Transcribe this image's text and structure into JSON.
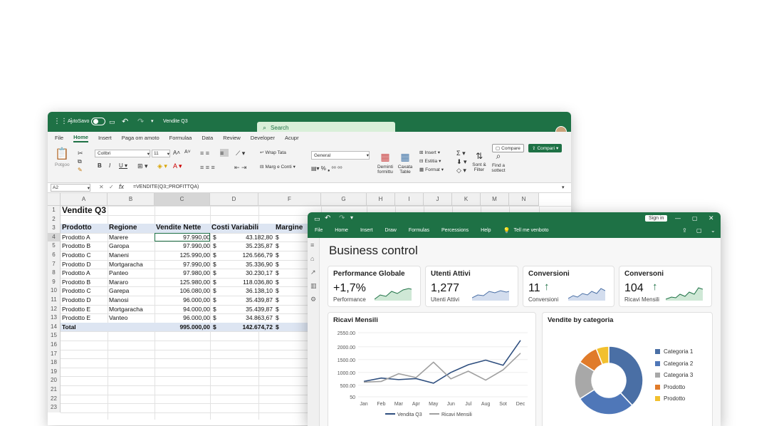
{
  "excel": {
    "autosave": "AutoSavo",
    "doc_title": "Vendite Q3",
    "search": "Search",
    "menu": [
      "File",
      "Home",
      "Insert",
      "Paga om amoto",
      "Formulaa",
      "Data",
      "Review",
      "Developer",
      "Acupr"
    ],
    "compare": "Compare",
    "share": "Compari",
    "ribbon": {
      "paste": "Potgoo",
      "font": "Collbri",
      "size": "11",
      "wrap": "Wrap Tata",
      "merge": "Marg e Conti",
      "numfmt": "General",
      "insert": "Insert",
      "delete": "Estitia",
      "format": "Format",
      "cond": "Deminti formittu",
      "table": "Caxata Table",
      "sort": "Sont & Filter",
      "find": "Find a sottect"
    },
    "namebox": "A2",
    "formula": "=VENDITE(Q3;;PROFITTQA)",
    "cols": [
      "A",
      "B",
      "C",
      "D",
      "F",
      "G",
      "H",
      "I",
      "J",
      "K",
      "M",
      "N"
    ],
    "title": "Vendite Q3",
    "headers": [
      "Prodotto",
      "Regione",
      "Vendite Nette",
      "Costi Variabili",
      "Margine"
    ],
    "rows": [
      [
        "Prodotto A",
        "Marere",
        "97.990,00",
        "$",
        "43.182,80",
        "$",
        "125,"
      ],
      [
        "Prodotto B",
        "Garopa",
        "97.990,00",
        "$",
        "35.235,87",
        "$",
        "120,"
      ],
      [
        "Prodotto C",
        "Maneni",
        "125.990,00",
        "$",
        "126.566,79",
        "$",
        "135,"
      ],
      [
        "Prodotto D",
        "Mortgaracha",
        "97.990,00",
        "$",
        "35.336,90",
        "$",
        "135,"
      ],
      [
        "Prodotto A",
        "Panteo",
        "97.980,00",
        "$",
        "30.230,17",
        "$",
        "86,"
      ],
      [
        "Prodotto B",
        "Mararo",
        "125.980,00",
        "$",
        "118.036,80",
        "$",
        "135,"
      ],
      [
        "Prodotto C",
        "Garepa",
        "106.080,00",
        "$",
        "36.138,10",
        "$",
        "125,"
      ],
      [
        "Prodotto D",
        "Manosi",
        "96.000,00",
        "$",
        "35.439,87",
        "$",
        "130,"
      ],
      [
        "Prodotto E",
        "Mortgaracha",
        "94.000,00",
        "$",
        "35.439,87",
        "$",
        "132,"
      ],
      [
        "Prodotto E",
        "Vanteo",
        "96.000,00",
        "$",
        "34.863,67",
        "$",
        "125,"
      ]
    ],
    "total": [
      "Total",
      "",
      "995.000,00",
      "$",
      "142.674,72",
      "$",
      "558,"
    ],
    "rownums": [
      "1",
      "2",
      "3",
      "4",
      "5",
      "6",
      "7",
      "8",
      "9",
      "10",
      "11",
      "12",
      "13",
      "14",
      "15",
      "16",
      "17",
      "18",
      "19",
      "20",
      "21",
      "22",
      "23"
    ]
  },
  "dash": {
    "signin": "Sign in",
    "menu": [
      "File",
      "Home",
      "Insert",
      "Draw",
      "Formulas",
      "Percessions",
      "Help"
    ],
    "tell": "Tell me venboto",
    "title": "Business control",
    "cards": [
      {
        "title": "Performance Globale",
        "value": "+1,7%",
        "sub": "Performance"
      },
      {
        "title": "Utenti Attivi",
        "value": "1,277",
        "sub": "Utenti Attivi"
      },
      {
        "title": "Conversioni",
        "value": "11",
        "sub": "Conversioni"
      },
      {
        "title": "Conversoni",
        "value": "104",
        "sub": "Ricavi Mensili"
      }
    ],
    "colors": {
      "green": "#1e7145",
      "blue": "#4a6fa5",
      "navy": "#2f4f7f",
      "gray": "#a8a8a8",
      "orange": "#e07b2a",
      "yellow": "#f2c02e",
      "lightgray": "#b0b0b0"
    }
  },
  "chart_data": [
    {
      "type": "line",
      "title": "Ricavi Mensili",
      "categories": [
        "Jan",
        "Feb",
        "Mar",
        "Apr",
        "May",
        "Jun",
        "Jul",
        "Aug",
        "Sot",
        "Dec"
      ],
      "yticks": [
        "2550.00",
        "2000.00",
        "1500.00",
        "1000.00",
        "500.00",
        "50"
      ],
      "ylim": [
        50,
        2550
      ],
      "series": [
        {
          "name": "Vendita Q3",
          "values": [
            650,
            780,
            720,
            760,
            580,
            1000,
            1300,
            1480,
            1280,
            2250
          ]
        },
        {
          "name": "Ricavi Mensili",
          "values": [
            620,
            650,
            950,
            800,
            1400,
            750,
            1050,
            700,
            1100,
            1750
          ]
        }
      ]
    },
    {
      "type": "pie",
      "title": "Vendite by categoria",
      "labels": [
        "Categoria 1",
        "Categoria 2",
        "Categoria 3",
        "Prodotto",
        "Prodotto"
      ],
      "values": [
        38,
        28,
        18,
        10,
        6
      ]
    }
  ]
}
